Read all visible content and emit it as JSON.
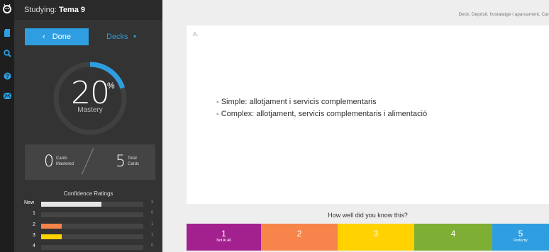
{
  "sidebar": {
    "studying_label": "Studying:",
    "deck_name": "Tema 9",
    "done_label": "Done",
    "decks_label": "Decks"
  },
  "mastery": {
    "percent": 20,
    "percent_text": "20",
    "percent_sign": "%",
    "label": "Mastery"
  },
  "cards": {
    "mastered": "0",
    "mastered_label_1": "Cards",
    "mastered_label_2": "Mastered",
    "total": "5",
    "total_label_1": "Total",
    "total_label_2": "Cards"
  },
  "confidence": {
    "title": "Confidence Ratings",
    "rows": [
      {
        "label": "New",
        "count": "3",
        "fraction": 0.59,
        "color": "#e6e6e6"
      },
      {
        "label": "1",
        "count": "0",
        "fraction": 0,
        "color": "#a3218e"
      },
      {
        "label": "2",
        "count": "1",
        "fraction": 0.2,
        "color": "#f7844a"
      },
      {
        "label": "3",
        "count": "1",
        "fraction": 0.2,
        "color": "#ffd200"
      },
      {
        "label": "4",
        "count": "0",
        "fraction": 0,
        "color": "#7fae34"
      }
    ]
  },
  "main": {
    "deck_label": "Deck: Depòsit, hostalatge i aparcament, Car",
    "card_side": "A.",
    "answer_lines": [
      "- Simple: allotjament i servicis complementaris",
      "- Complex: allotjament, servicis complementaris i alimentació"
    ],
    "question": "How well did you know this?",
    "ratings": [
      {
        "num": "1",
        "text": "Not At All",
        "color": "#a3218e"
      },
      {
        "num": "2",
        "text": "",
        "color": "#f7844a"
      },
      {
        "num": "3",
        "text": "",
        "color": "#ffd200"
      },
      {
        "num": "4",
        "text": "",
        "color": "#7fae34"
      },
      {
        "num": "5",
        "text": "Perfectly",
        "color": "#2e9ee0"
      }
    ]
  },
  "colors": {
    "accent": "#2e9ee0",
    "panel": "#333333"
  },
  "icons": [
    "logo-icon",
    "decks-icon",
    "search-icon",
    "help-icon",
    "mail-icon",
    "chevron-left-icon",
    "caret-down-icon"
  ]
}
